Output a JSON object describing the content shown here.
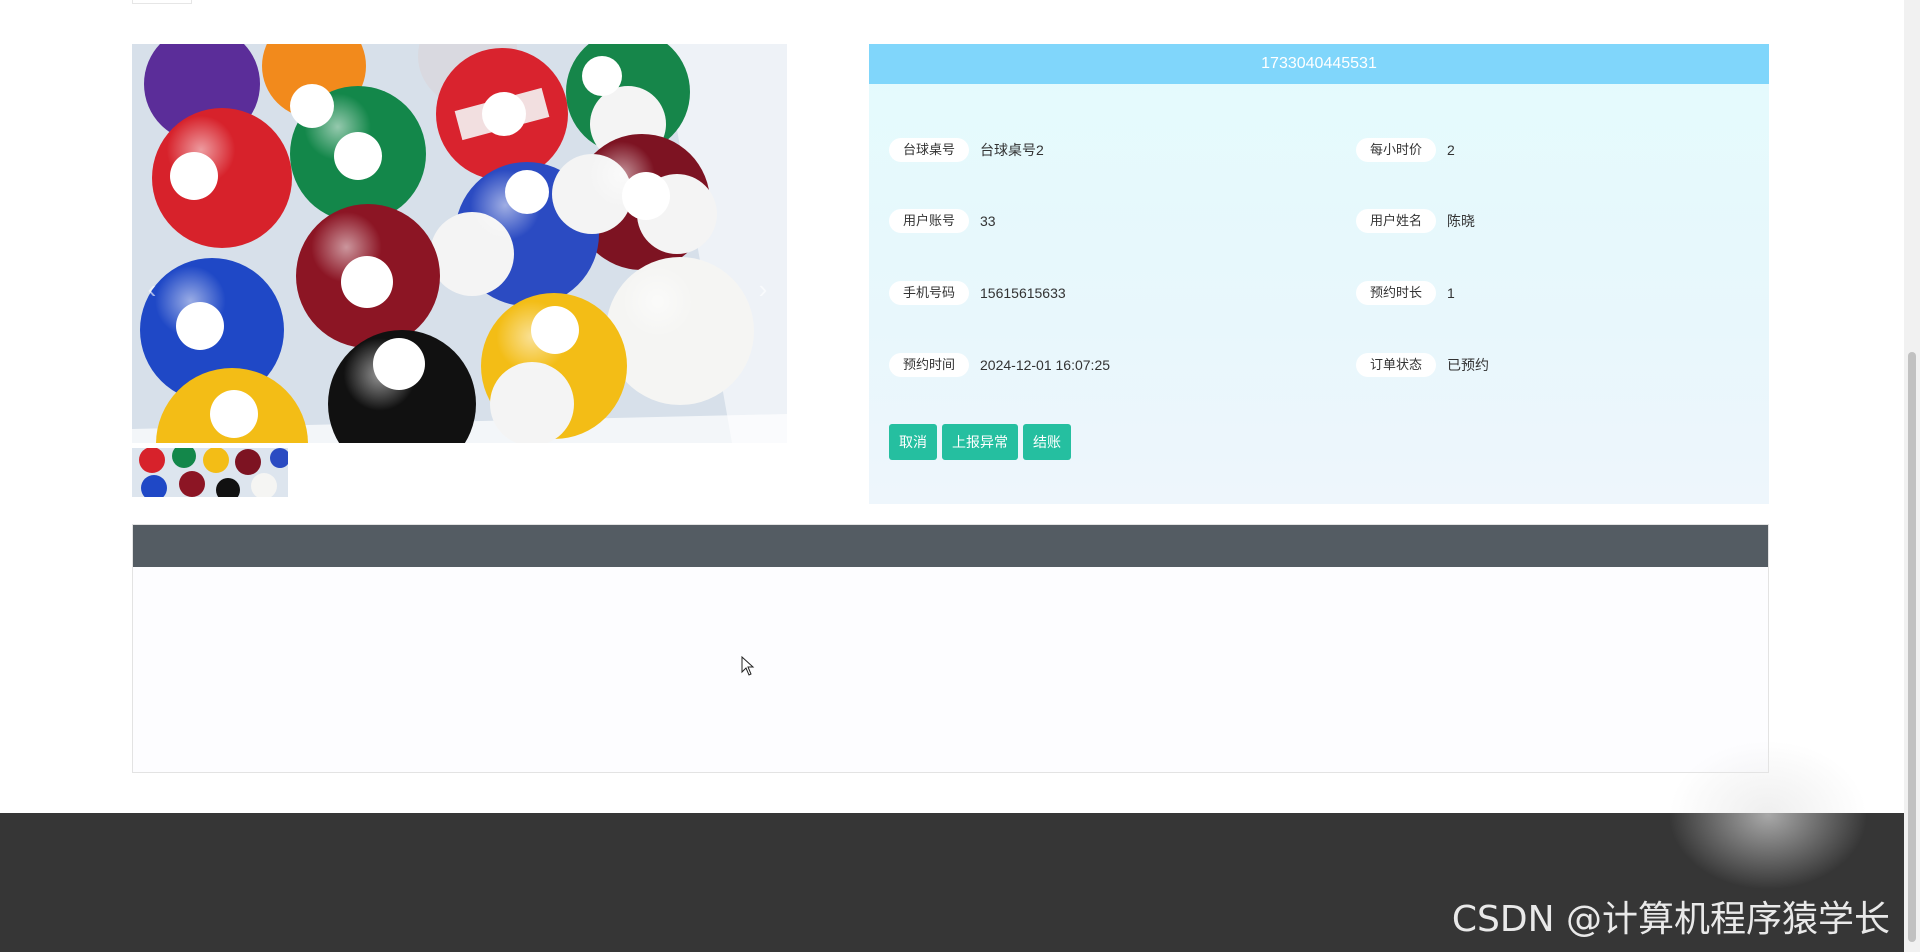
{
  "detail": {
    "header_title": "1733040445531",
    "fields": [
      {
        "label": "台球桌号",
        "value": "台球桌号2"
      },
      {
        "label": "每小时价",
        "value": "2"
      },
      {
        "label": "用户账号",
        "value": "33"
      },
      {
        "label": "用户姓名",
        "value": "陈晓"
      },
      {
        "label": "手机号码",
        "value": "15615615633"
      },
      {
        "label": "预约时长",
        "value": "1"
      },
      {
        "label": "预约时间",
        "value": "2024-12-01 16:07:25"
      },
      {
        "label": "订单状态",
        "value": "已预约"
      }
    ],
    "actions": {
      "cancel": "取消",
      "report": "上报异常",
      "checkout": "结账"
    }
  },
  "gallery": {
    "prev_icon": "‹",
    "next_icon": "›"
  },
  "footer": {
    "watermark": "CSDN @计算机程序猿学长"
  },
  "colors": {
    "header_blue": "#80d6fb",
    "button_teal": "#25bfa0",
    "section_header": "#545c63",
    "footer_bg": "#363636"
  }
}
